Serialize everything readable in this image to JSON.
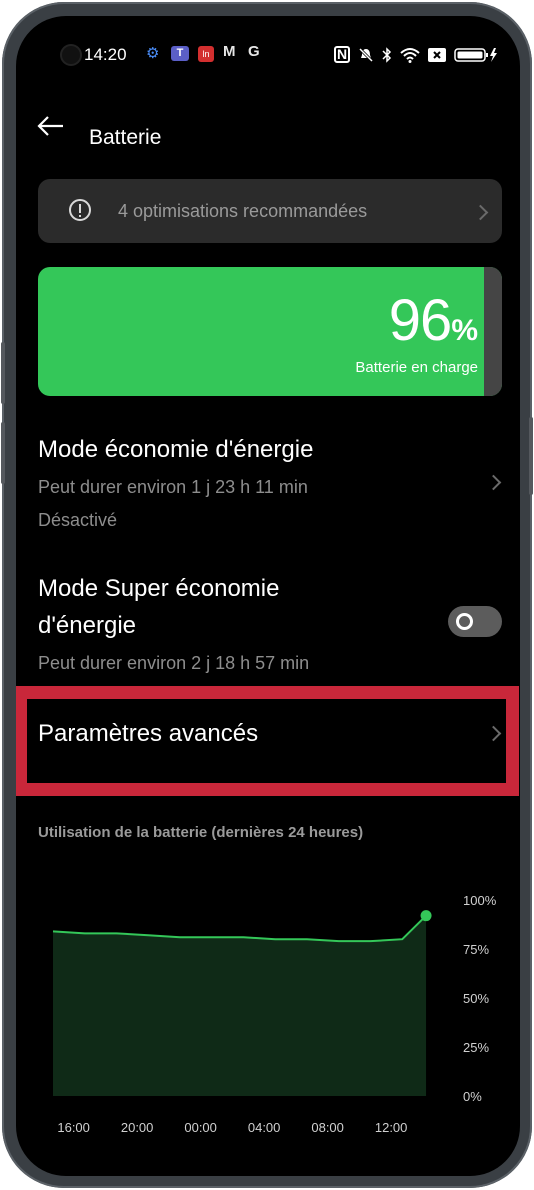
{
  "status_bar": {
    "time": "14:20",
    "left_icons": [
      "settings-gear-icon",
      "teams-icon",
      "app-icon",
      "gmail-icon",
      "google-icon"
    ],
    "right_icons": [
      "nfc-icon",
      "mute-icon",
      "bluetooth-icon",
      "wifi-icon",
      "sim-off-icon",
      "battery-charging-icon"
    ]
  },
  "header": {
    "title": "Batterie"
  },
  "optimisations": {
    "label": "4 optimisations recommandées"
  },
  "battery": {
    "percent_number": "96",
    "percent_symbol": "%",
    "level": 0.96,
    "status": "Batterie en charge",
    "color": "#34c759"
  },
  "power_saving": {
    "title": "Mode économie d'énergie",
    "duration": "Peut durer environ 1 j 23 h 11 min",
    "state": "Désactivé"
  },
  "super_saving": {
    "title_line1": "Mode Super économie",
    "title_line2": "d'énergie",
    "duration": "Peut durer environ 2 j 18 h 57 min",
    "enabled": false
  },
  "advanced": {
    "label": "Paramètres avancés"
  },
  "usage_chart": {
    "title": "Utilisation de la batterie (dernières 24 heures)"
  },
  "chart_data": {
    "type": "area",
    "title": "Utilisation de la batterie (dernières 24 heures)",
    "x_labels": [
      "16:00",
      "20:00",
      "00:00",
      "04:00",
      "08:00",
      "12:00"
    ],
    "y_labels": [
      "100%",
      "75%",
      "50%",
      "25%",
      "0%"
    ],
    "ylim": [
      0,
      100
    ],
    "grid": false,
    "series": [
      {
        "x_hours": [
          0,
          2,
          4,
          6,
          8,
          10,
          12,
          14,
          16,
          18,
          20,
          22,
          23.5
        ],
        "values": [
          84,
          83,
          83,
          82,
          81,
          81,
          81,
          80,
          80,
          79,
          79,
          80,
          92
        ]
      }
    ],
    "line_color": "#34c759",
    "fill_color": "#0f2a17"
  }
}
